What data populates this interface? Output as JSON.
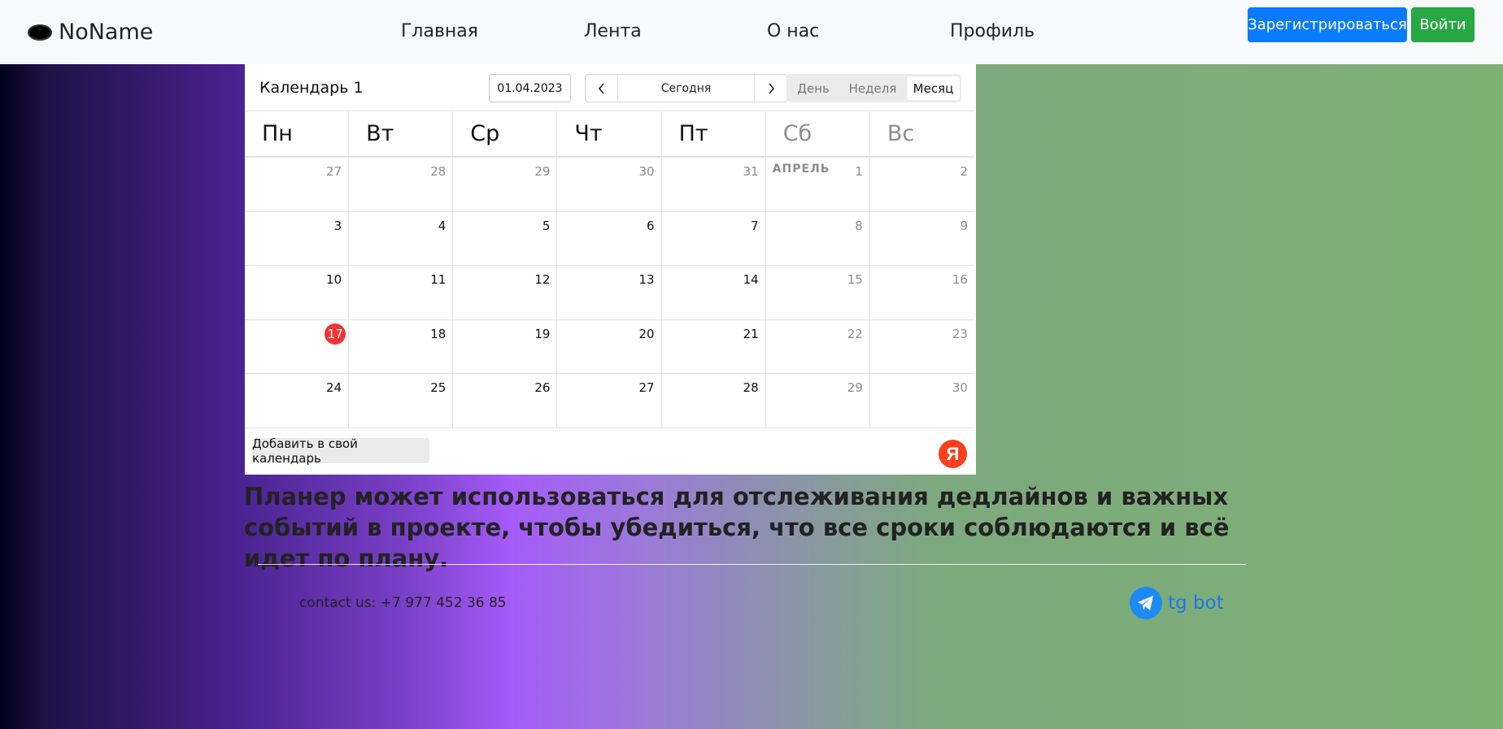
{
  "nav": {
    "brand": "NoName",
    "links": [
      "Главная",
      "Лента",
      "О нас",
      "Профиль"
    ],
    "register_label": "Зарегистрироваться",
    "login_label": "Войти"
  },
  "calendar": {
    "title": "Календарь 1",
    "date_value": "01.04.2023",
    "today_label": "Сегодня",
    "views": [
      "День",
      "Неделя",
      "Месяц"
    ],
    "active_view": "Месяц",
    "weekdays": [
      "Пн",
      "Вт",
      "Ср",
      "Чт",
      "Пт",
      "Сб",
      "Вс"
    ],
    "month_label": "АПРЕЛЬ",
    "today": 17,
    "weeks": [
      [
        "27",
        "28",
        "29",
        "30",
        "31",
        "1",
        "2"
      ],
      [
        "3",
        "4",
        "5",
        "6",
        "7",
        "8",
        "9"
      ],
      [
        "10",
        "11",
        "12",
        "13",
        "14",
        "15",
        "16"
      ],
      [
        "17",
        "18",
        "19",
        "20",
        "21",
        "22",
        "23"
      ],
      [
        "24",
        "25",
        "26",
        "27",
        "28",
        "29",
        "30"
      ]
    ],
    "add_button_label": "Добавить в свой календарь",
    "yandex_logo_letter": "Я"
  },
  "description": "Планер может использоваться для отслеживания дедлайнов и важных событий в проекте, чтобы убедиться, что все сроки соблюдаются и всё идет по плану.",
  "footer": {
    "contact": "contact us: +7 977 452 36 85",
    "tg_label": "tg bot"
  },
  "colors": {
    "register": "#0b7bfd",
    "login": "#28a745",
    "today_highlight": "#ef3535",
    "link": "#1976f1"
  }
}
